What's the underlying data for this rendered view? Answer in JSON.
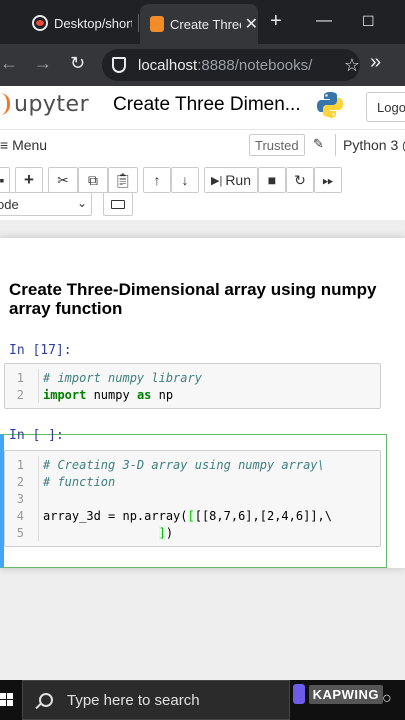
{
  "browser": {
    "tabs": [
      {
        "title": "Desktop/short"
      },
      {
        "title": "Create Three"
      }
    ],
    "new_tab": "+",
    "url_host": "localhost",
    "url_rest": ":8888/notebooks/"
  },
  "jupyter": {
    "logo_text": "upyter",
    "notebook_title": "Create Three Dimen...",
    "logout_label": "Logo"
  },
  "menubar": {
    "menu_label": "Menu",
    "trusted_label": "Trusted",
    "kernel_label": "Python 3"
  },
  "toolbar": {
    "run_label": "Run",
    "cell_type": "ode"
  },
  "notebook": {
    "heading": "Create Three-Dimensional array using numpy array function",
    "cells": [
      {
        "prompt": "In [17]:",
        "lines": [
          {
            "num": "1",
            "comment": "# import numpy library"
          },
          {
            "num": "2",
            "kw1": "import",
            "mid": " numpy ",
            "kw2": "as",
            "end": " np"
          }
        ]
      },
      {
        "prompt": "In [ ]:",
        "lines": [
          {
            "num": "1",
            "comment": "# Creating 3-D array using numpy array\\"
          },
          {
            "num": "2",
            "comment": "# function"
          },
          {
            "num": "3",
            "code": ""
          },
          {
            "num": "4",
            "code_pre": "array_3d = np.array(",
            "code_hl": "[",
            "code_post": "[[8,7,6],[2,4,6]],\\"
          },
          {
            "num": "5",
            "code_pad": "                ",
            "code_hl": "]",
            "code_post": ")"
          }
        ]
      }
    ]
  },
  "taskbar": {
    "search_placeholder": "Type here to search",
    "watermark": "KAPWING"
  }
}
